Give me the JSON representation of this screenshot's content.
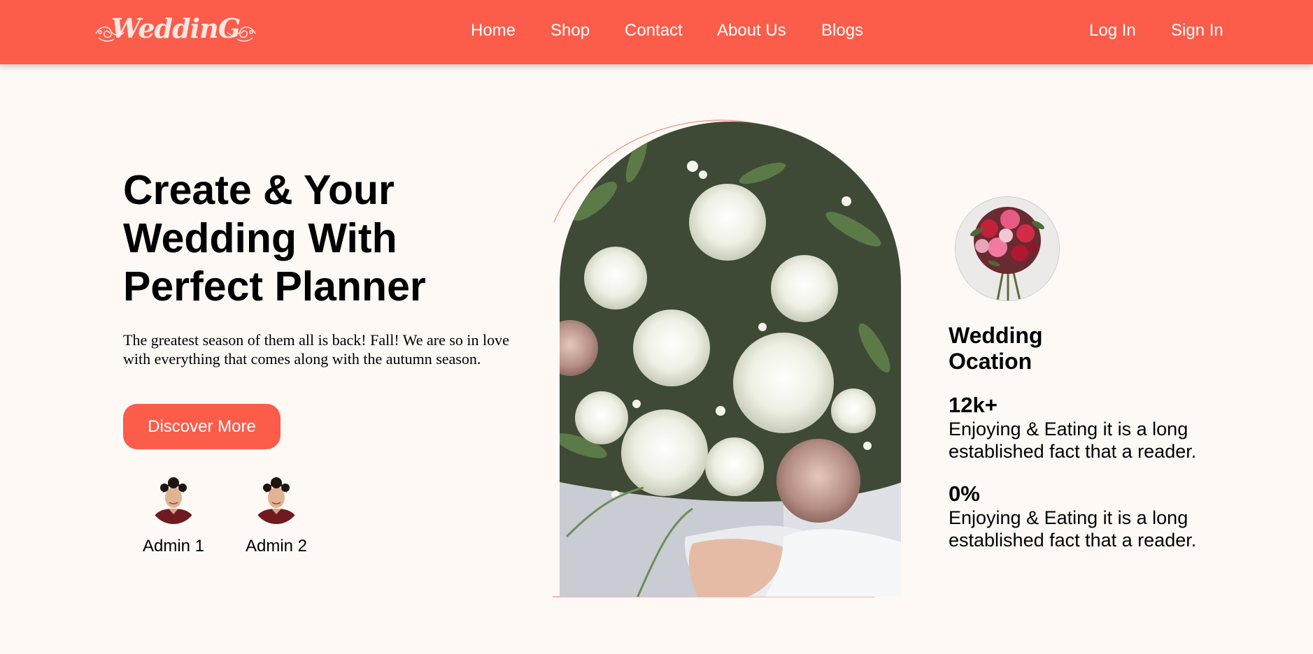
{
  "brand": {
    "logo_text": "WeddinG"
  },
  "nav": {
    "links": [
      "Home",
      "Shop",
      "Contact",
      "About Us",
      "Blogs"
    ],
    "log_in": "Log In",
    "sign_in": "Sign In"
  },
  "hero": {
    "title": "Create & Your Wedding With Perfect Planner",
    "description": "The greatest season of them all is back! Fall! We are so in love with everything that comes along with the autumn season.",
    "cta_label": "Discover More"
  },
  "admins": [
    {
      "name": "Admin 1"
    },
    {
      "name": "Admin 2"
    }
  ],
  "sidebar": {
    "title": "Wedding Ocation",
    "stats": [
      {
        "value": "12k+",
        "text": "Enjoying & Eating it is a long established fact that a reader."
      },
      {
        "value": "0%",
        "text": "Enjoying & Eating it is a long established fact that a reader."
      }
    ]
  },
  "colors": {
    "accent": "#fc5c4a",
    "background": "#fff9f6"
  }
}
